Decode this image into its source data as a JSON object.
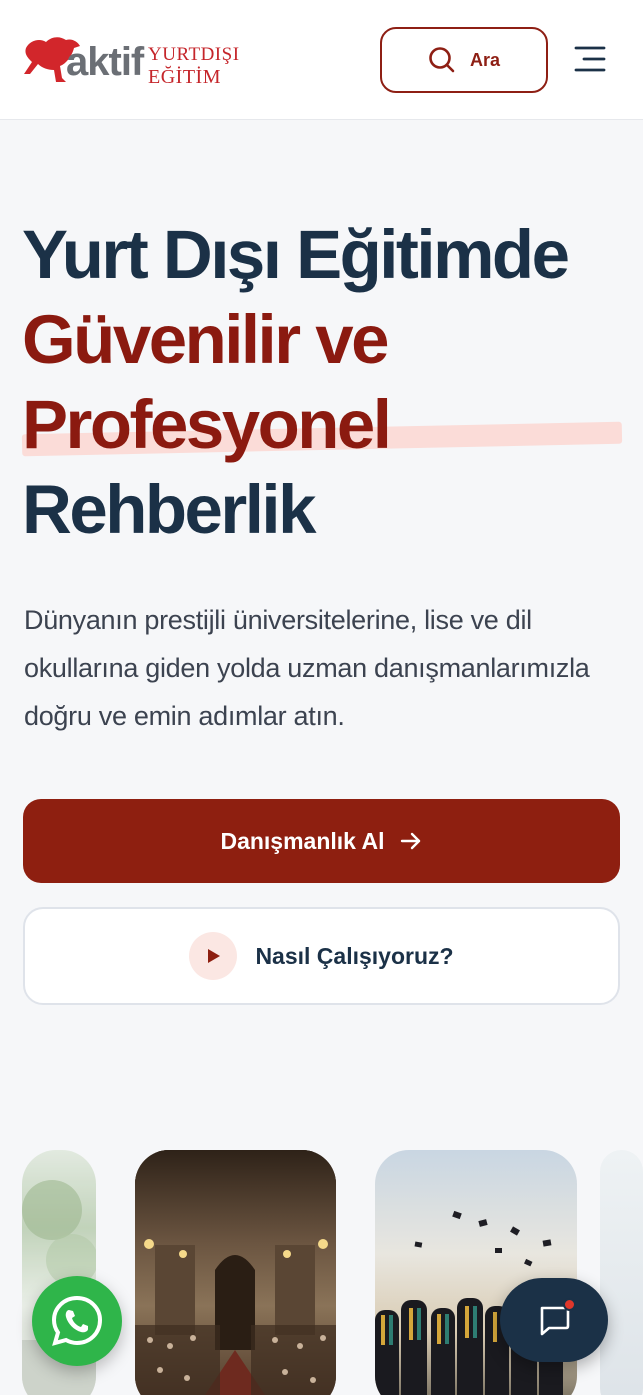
{
  "header": {
    "logo_word": "aktif",
    "logo_line1": "YURTDIŞI",
    "logo_line2": "EĞİTİM",
    "search_label": "Ara"
  },
  "hero": {
    "title_line1": "Yurt Dışı Eğitimde",
    "title_line2": "Güvenilir ve",
    "title_line3": "Profesyonel",
    "title_line4": "Rehberlik",
    "description": "Dünyanın prestijli üniversitelerine, lise ve dil okullarına giden yolda uzman danışmanlarımızla doğru ve emin adımlar atın.",
    "cta_primary": "Danışmanlık Al",
    "cta_secondary": "Nasıl Çalışıyoruz?"
  },
  "colors": {
    "brand_red": "#8e1f10",
    "navy": "#1b3147",
    "whatsapp_green": "#2fb54a"
  },
  "icons": {
    "search": "search-icon",
    "menu": "hamburger-menu-icon",
    "arrow": "arrow-right-icon",
    "play": "play-icon",
    "whatsapp": "whatsapp-icon",
    "chat": "chat-bubble-icon"
  }
}
